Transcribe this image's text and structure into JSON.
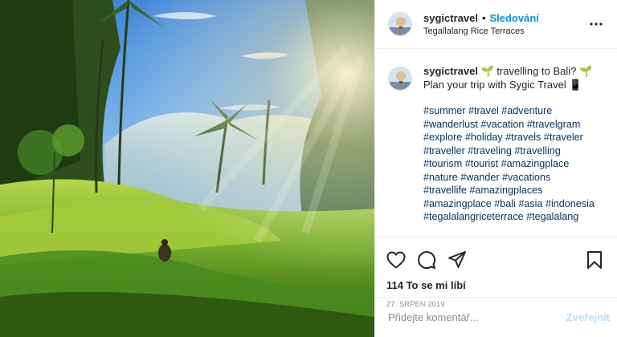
{
  "header": {
    "username": "sygictravel",
    "separator": "•",
    "follow_label": "Sledování",
    "location": "Tegallalang Rice Terraces",
    "avatar_icon": "balloon-photo-avatar",
    "more_icon": "ellipsis-icon"
  },
  "caption": {
    "username": "sygictravel",
    "emoji_1": "🌱",
    "text_1": " travelling to Bali? ",
    "emoji_2": "🌱",
    "text_2": " Plan your trip with Sygic Travel ",
    "emoji_3": "📱",
    "hashtags": [
      "#summer",
      "#travel",
      "#adventure",
      "#wanderlust",
      "#vacation",
      "#travelgram",
      "#explore",
      "#holiday",
      "#travels",
      "#traveler",
      "#traveller",
      "#traveling",
      "#travelling",
      "#tourism",
      "#tourist",
      "#amazingplace",
      "#nature",
      "#wander",
      "#vacations",
      "#travellife",
      "#amazingplaces",
      "#amazingplace",
      "#bali",
      "#asia",
      "#indonesia",
      "#tegalalangriceterrace",
      "#tegalalang"
    ]
  },
  "actions": {
    "icons": [
      "heart-icon",
      "comment-icon",
      "share-icon",
      "bookmark-icon"
    ],
    "likes": "114 To se mi líbí",
    "date": "27. SRPEN 2019"
  },
  "comment": {
    "placeholder": "Přidejte komentář...",
    "post_label": "Zveřejnit"
  },
  "colors": {
    "link": "#0095f6",
    "hashtag": "#00376b",
    "post_disabled": "#b2dffc",
    "muted": "#8e8e8e"
  }
}
